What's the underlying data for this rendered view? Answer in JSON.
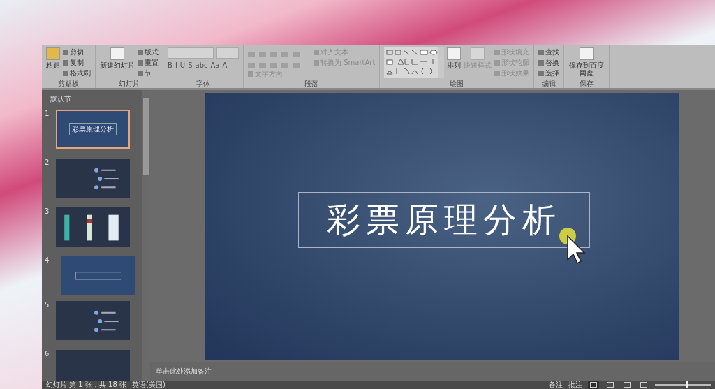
{
  "ribbon": {
    "groups": [
      {
        "label": "剪贴板",
        "items": [
          {
            "kind": "large",
            "label": "粘贴",
            "disabled": false
          },
          {
            "kind": "small",
            "label": "剪切",
            "disabled": false
          },
          {
            "kind": "small",
            "label": "复制",
            "disabled": false
          },
          {
            "kind": "small",
            "label": "格式刷",
            "disabled": false
          }
        ]
      },
      {
        "label": "幻灯片",
        "items": [
          {
            "kind": "large",
            "label": "新建幻灯片",
            "disabled": false
          },
          {
            "kind": "small",
            "label": "版式",
            "disabled": false
          },
          {
            "kind": "small",
            "label": "重置",
            "disabled": false
          },
          {
            "kind": "small",
            "label": "节",
            "disabled": false
          }
        ]
      },
      {
        "label": "字体",
        "items": [
          {
            "kind": "font",
            "glyphs": [
              "B",
              "I",
              "U",
              "S",
              "abc",
              "Aa",
              "A"
            ]
          }
        ]
      },
      {
        "label": "段落",
        "items": [
          {
            "kind": "para"
          },
          {
            "kind": "small",
            "label": "文字方向",
            "disabled": true
          },
          {
            "kind": "small",
            "label": "对齐文本",
            "disabled": true
          },
          {
            "kind": "small",
            "label": "转换为 SmartArt",
            "disabled": true
          }
        ]
      },
      {
        "label": "绘图",
        "items": [
          {
            "kind": "shapes"
          },
          {
            "kind": "large",
            "label": "排列",
            "disabled": false
          },
          {
            "kind": "large",
            "label": "快速样式",
            "disabled": true
          },
          {
            "kind": "small",
            "label": "形状填充",
            "disabled": true
          },
          {
            "kind": "small",
            "label": "形状轮廓",
            "disabled": true
          },
          {
            "kind": "small",
            "label": "形状效果",
            "disabled": true
          }
        ]
      },
      {
        "label": "编辑",
        "items": [
          {
            "kind": "small",
            "label": "查找",
            "disabled": false
          },
          {
            "kind": "small",
            "label": "替换",
            "disabled": false
          },
          {
            "kind": "small",
            "label": "选择",
            "disabled": false
          }
        ]
      },
      {
        "label": "保存",
        "items": [
          {
            "kind": "large",
            "label": "保存到百度网盘",
            "disabled": false
          }
        ]
      }
    ]
  },
  "slide_panel": {
    "section": "默认节",
    "slides": [
      {
        "number": "1",
        "selected": true,
        "kind": "title",
        "title": "彩票原理分析"
      },
      {
        "number": "2",
        "selected": false,
        "kind": "list"
      },
      {
        "number": "3",
        "selected": false,
        "kind": "pictures"
      },
      {
        "number": "4",
        "selected": false,
        "kind": "section"
      },
      {
        "number": "5",
        "selected": false,
        "kind": "list"
      },
      {
        "number": "6",
        "selected": false,
        "kind": "dark"
      }
    ]
  },
  "slide": {
    "title": "彩票原理分析"
  },
  "notes": {
    "placeholder": "单击此处添加备注"
  },
  "status_bar": {
    "slide_info": "幻灯片 第 1 张，共 18 张",
    "language": "英语(美国)",
    "notes_button": "备注",
    "comments_button": "批注",
    "views": [
      {
        "selected": true
      },
      {
        "selected": false
      },
      {
        "selected": false
      },
      {
        "selected": false
      }
    ],
    "zoom": {
      "level": 0.55
    }
  }
}
